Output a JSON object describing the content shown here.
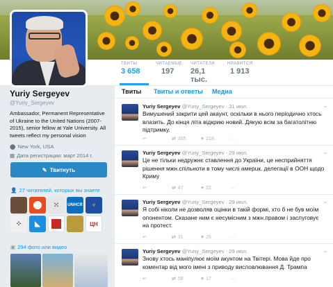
{
  "profile": {
    "name": "Yuriy Sergeyev",
    "handle": "@Yuriy_Sergeyev",
    "bio": "Ambassador, Permanent Representative of Ukraine to the United Nations (2007-2015), senior fellow at Yale University. All tweets reflect my personal vision",
    "location": "New York, USA",
    "joined": "Дата регистрации: март 2014 г.",
    "tweet_button": "Твитнуть"
  },
  "stats": [
    {
      "label": "ТВИТЫ",
      "value": "3 658"
    },
    {
      "label": "ЧИТАЕМЫЕ",
      "value": "197"
    },
    {
      "label": "ЧИТАТЕЛИ",
      "value": "26,1 тыс."
    },
    {
      "label": "НРАВИТСЯ",
      "value": "1 913"
    }
  ],
  "followers_you_know": "27 читателей, которых вы знаете",
  "media_count": "294 фото или видео",
  "follower_tiles": [
    {
      "label": "",
      "color": "#6b4e3a"
    },
    {
      "label": "",
      "color": "#e84b1f"
    },
    {
      "label": "",
      "color": "#444444"
    },
    {
      "label": "UNHCR",
      "color": "#0a6fbf"
    },
    {
      "label": "",
      "color": "#1c4ea3"
    },
    {
      "label": "",
      "color": "#1a1a1a"
    },
    {
      "label": "",
      "color": "#1d8fe0"
    },
    {
      "label": "",
      "color": "#c62828"
    },
    {
      "label": "",
      "color": "#b89b3a"
    },
    {
      "label": "ЦН",
      "color": "#ffffff"
    }
  ],
  "tabs": [
    "Твиты",
    "Твиты и ответы",
    "Медиа"
  ],
  "tweets": [
    {
      "name": "Yuriy Sergeyev",
      "handle": "@Yuriy_Sergeyev",
      "date": "· 31 июл.",
      "text": "Вимушений закрити цей акаунт, оскільки в нього періодично хтось влазить. До кінця літа відкрию новий. Дякую всім за багатолітню підтримку.",
      "retweets": "355",
      "likes": "218"
    },
    {
      "name": "Yuriy Sergeyev",
      "handle": "@Yuriy_Sergeyev",
      "date": "· 29 июл.",
      "text": "Це не тільки недружнє ставлення до України, це несприйняття рішення мжн.спільноти в тому числі амерuк. делегації в ООН щодо Криму",
      "retweets": "47",
      "likes": "22"
    },
    {
      "name": "Yuriy Sergeyev",
      "handle": "@Yuriy_Sergeyev",
      "date": "· 29 июл.",
      "text": "Я собі ніколи не дозволяв оцінки в такій формі, хто б не був моїм опонентом. Сказане ним є несумісним з мжн.правом і заслуговує на протест.",
      "retweets": "31",
      "likes": "25"
    },
    {
      "name": "Yuriy Sergeyev",
      "handle": "@Yuriy_Sergeyev",
      "date": "· 29 июл.",
      "text": "Знову хтось маніпулює моїм акунтом на Твітері. Мова йде про коментар від мого імені з приводу висловлювання Д. Трампа",
      "retweets": "56",
      "likes": "17"
    }
  ]
}
